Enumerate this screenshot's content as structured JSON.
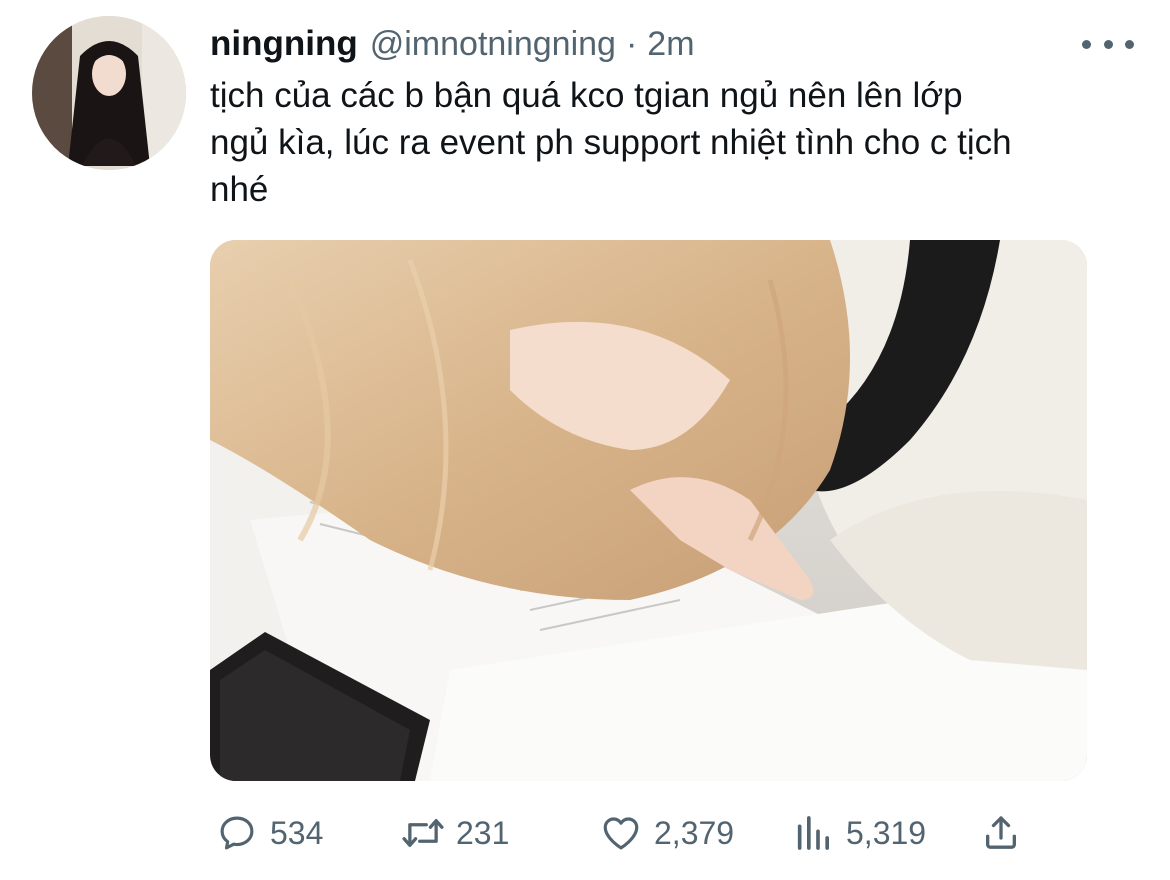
{
  "tweet": {
    "author": {
      "display_name": "ningning",
      "handle": "@imnotningning",
      "avatar": "avatar"
    },
    "separator": "·",
    "time": "2m",
    "text_lines": [
      "tịch của các b bận quá kco tgian ngủ nên lên lớp",
      "ngủ kìa, lúc ra event ph support nhiệt tình cho c tịch",
      "nhé"
    ],
    "media": {
      "type": "photo",
      "icon": "photo"
    },
    "actions": {
      "reply": {
        "icon": "reply-icon",
        "count": "534"
      },
      "retweet": {
        "icon": "retweet-icon",
        "count": "231"
      },
      "like": {
        "icon": "heart-icon",
        "count": "2,379"
      },
      "views": {
        "icon": "views-icon",
        "count": "5,319"
      },
      "share": {
        "icon": "share-icon"
      }
    },
    "more_icon": "more-icon"
  },
  "colors": {
    "text_primary": "#0f1419",
    "text_secondary": "#536471",
    "background": "#ffffff"
  }
}
